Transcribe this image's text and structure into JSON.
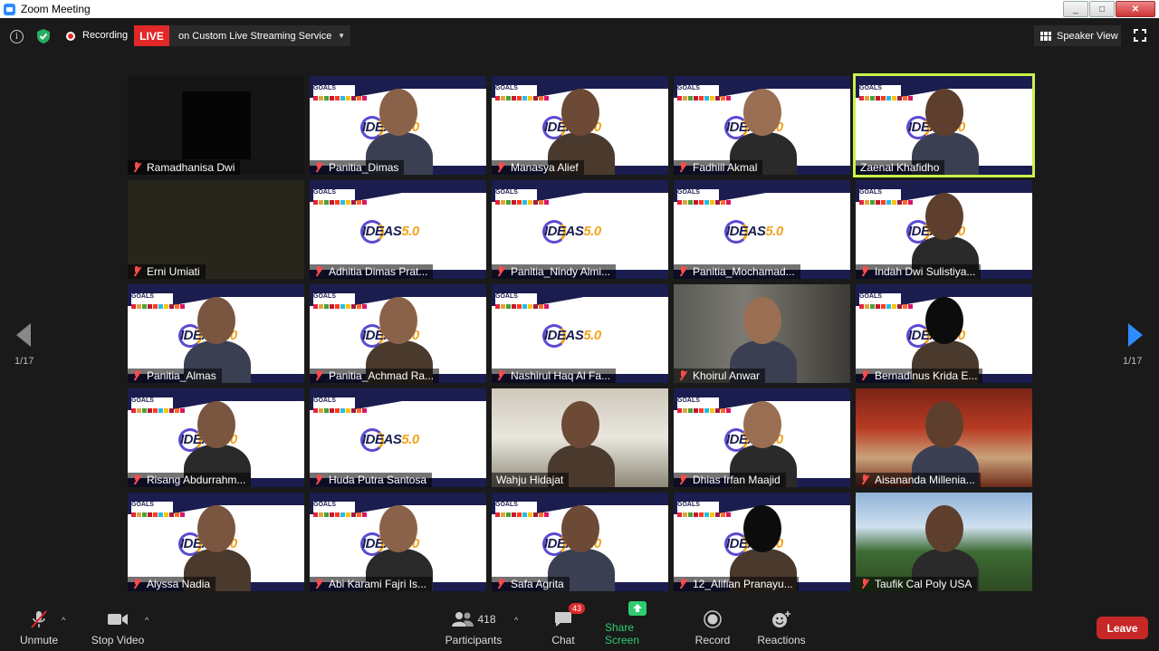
{
  "window": {
    "title": "Zoom Meeting",
    "min": "_",
    "max": "□",
    "close": "✕"
  },
  "topbar": {
    "recording_label": "Recording",
    "live_label": "LIVE",
    "stream_label": "on Custom Live Streaming Service",
    "speaker_view_label": "Speaker View"
  },
  "slide": {
    "goals_text": "GOALS",
    "ideas_text": "IDEAS",
    "ideas_num": "5.0"
  },
  "participants_grid": [
    {
      "name": "Ramadhanisa Dwi",
      "muted": true,
      "video": "blackbox"
    },
    {
      "name": "Panitia_Dimas",
      "muted": true,
      "video": "slide-person"
    },
    {
      "name": "Manasya Alief",
      "muted": true,
      "video": "slide-person"
    },
    {
      "name": "Fadhiil Akmal",
      "muted": true,
      "video": "slide-person"
    },
    {
      "name": "Zaenal Khafidho",
      "muted": false,
      "video": "slide-person",
      "active": true
    },
    {
      "name": "Erni Umiati",
      "muted": true,
      "video": "olive"
    },
    {
      "name": "Adhitia Dimas Prat...",
      "muted": true,
      "video": "slide"
    },
    {
      "name": "Panitia_Nindy Almi...",
      "muted": true,
      "video": "slide"
    },
    {
      "name": "Panitia_Mochamad...",
      "muted": true,
      "video": "slide"
    },
    {
      "name": "Indah Dwi Sulistiya...",
      "muted": true,
      "video": "slide-person"
    },
    {
      "name": "Panitia_Almas",
      "muted": true,
      "video": "slide-person"
    },
    {
      "name": "Panitia_Achmad Ra...",
      "muted": true,
      "video": "slide-person"
    },
    {
      "name": "Nashirul Haq Al Fa...",
      "muted": true,
      "video": "slide"
    },
    {
      "name": "Khoirul Anwar",
      "muted": true,
      "video": "photo"
    },
    {
      "name": "Bernadinus Krida E...",
      "muted": true,
      "video": "slide-person"
    },
    {
      "name": "Risang Abdurrahm...",
      "muted": true,
      "video": "slide-person"
    },
    {
      "name": "Huda Putra Santosa",
      "muted": true,
      "video": "slide"
    },
    {
      "name": "Wahju Hidajat",
      "muted": false,
      "video": "photo"
    },
    {
      "name": "Dhias Irfan Maajid",
      "muted": true,
      "video": "slide-person"
    },
    {
      "name": "Aisananda Millenia...",
      "muted": true,
      "video": "photo"
    },
    {
      "name": "Alyssa Nadia",
      "muted": true,
      "video": "slide-person"
    },
    {
      "name": "Abi Karami Fajri Is...",
      "muted": true,
      "video": "slide-person"
    },
    {
      "name": "Safa Agrita",
      "muted": true,
      "video": "slide-person"
    },
    {
      "name": "12_Alifian Pranayu...",
      "muted": true,
      "video": "slide-person"
    },
    {
      "name": "Taufik Cal Poly USA",
      "muted": true,
      "video": "photo"
    }
  ],
  "pagination": {
    "left_page": "1/17",
    "right_page": "1/17"
  },
  "toolbar": {
    "unmute_label": "Unmute",
    "stop_video_label": "Stop Video",
    "participants_count": "418",
    "participants_label": "Participants",
    "chat_label": "Chat",
    "chat_badge": "43",
    "share_label": "Share Screen",
    "record_label": "Record",
    "reactions_label": "Reactions",
    "leave_label": "Leave"
  },
  "colors": {
    "accent": "#2d8cff",
    "live_red": "#e02828",
    "share_green": "#2ecc71",
    "active_speaker": "#c8f24a"
  }
}
